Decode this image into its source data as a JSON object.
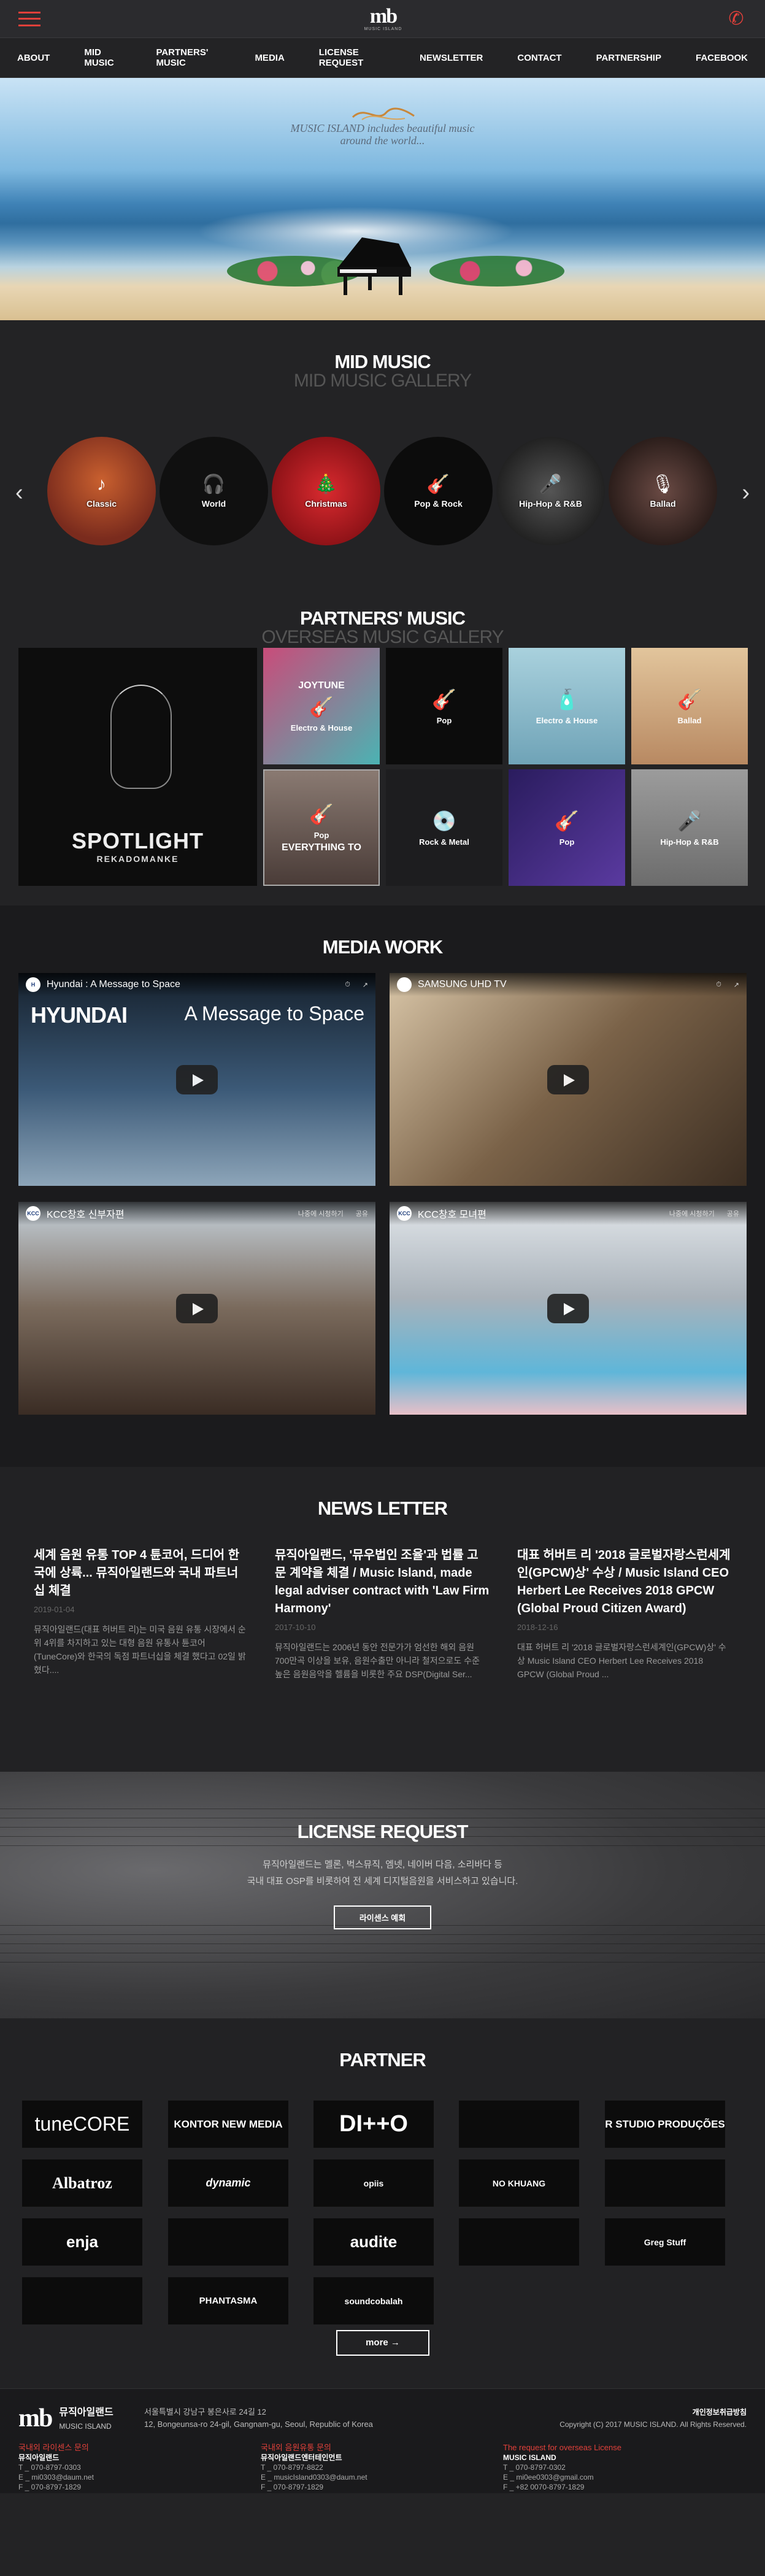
{
  "brand": {
    "logo_text": "mb",
    "logo_sub": "MUSIC ISLAND"
  },
  "nav": [
    "ABOUT",
    "MID MUSIC",
    "PARTNERS' MUSIC",
    "MEDIA",
    "LICENSE REQUEST",
    "NEWSLETTER",
    "CONTACT",
    "PARTNERSHIP",
    "FACEBOOK"
  ],
  "hero": {
    "caption_line1": "MUSIC ISLAND includes beautiful music",
    "caption_line2": "around the world..."
  },
  "mid_music": {
    "title": "MID MUSIC",
    "subtitle": "MID MUSIC GALLERY",
    "items": [
      {
        "label": "Classic",
        "color": "#7a2b1d"
      },
      {
        "label": "World",
        "color": "#101010"
      },
      {
        "label": "Christmas",
        "color": "#a3161b"
      },
      {
        "label": "Pop & Rock",
        "color": "#0c0c0c"
      },
      {
        "label": "Hip-Hop & R&B",
        "color": "#2a2a2a"
      },
      {
        "label": "Ballad",
        "color": "#3c2a26"
      }
    ]
  },
  "partners_music": {
    "title": "PARTNERS' MUSIC",
    "subtitle": "OVERSEAS MUSIC GALLERY",
    "feature_title": "SPOTLIGHT",
    "feature_sub": "REKADOMANKE",
    "tiles": [
      {
        "label": "Electro & House",
        "top_text": "JOYTUNE",
        "color": "#b8446c"
      },
      {
        "label": "Pop",
        "top_text": "",
        "color": "#0c0c0c"
      },
      {
        "label": "Electro & House",
        "top_text": "",
        "color": "#8fb9c8"
      },
      {
        "label": "Ballad",
        "top_text": "",
        "color": "#c89e7a"
      },
      {
        "label": "Pop",
        "top_text": "EVERYTHING TO",
        "color": "#6b5a55"
      },
      {
        "label": "Rock & Metal",
        "top_text": "",
        "color": "#222224"
      },
      {
        "label": "Pop",
        "top_text": "",
        "color": "#3a2a6a"
      },
      {
        "label": "Hip-Hop & R&B",
        "top_text": "",
        "color": "#8c8c8c"
      }
    ]
  },
  "media_work": {
    "title": "MEDIA WORK",
    "videos": [
      {
        "title": "Hyundai : A Message to Space",
        "badge": "H",
        "overlay_left": "HYUNDAI",
        "overlay_right": "A Message to Space",
        "watch_later": "나중에 시청하기",
        "share": "공유",
        "bg": "#3a4a5c"
      },
      {
        "title": "SAMSUNG UHD TV",
        "badge": "",
        "overlay_left": "",
        "overlay_right": "",
        "watch_later": "나중에 시청하기",
        "share": "공유",
        "bg": "#6b5a48"
      },
      {
        "title": "KCC창호 신부자편",
        "badge": "KCC",
        "overlay_left": "",
        "overlay_right": "",
        "watch_later": "나중에 시청하기",
        "share": "공유",
        "bg": "#5a5048"
      },
      {
        "title": "KCC창호 모녀편",
        "badge": "KCC",
        "overlay_left": "",
        "overlay_right": "",
        "watch_later": "나중에 시청하기",
        "share": "공유",
        "bg": "#8a8a8c"
      }
    ]
  },
  "news_letter": {
    "title": "NEWS LETTER",
    "items": [
      {
        "headline": "세계 음원 유통 TOP 4 튠코어, 드디어 한국에 상륙... 뮤직아일랜드와 국내 파트너십 체결",
        "date": "2019-01-04",
        "excerpt": "뮤직아일랜드(대표 허버트 리)는 미국 음원 유통 시장에서 순위 4위를 차지하고 있는 대형 음원 유통사 튠코어(TuneCore)와 한국의 독점 파트너십을 체결 했다고 02일 밝혔다...."
      },
      {
        "headline": "뮤직아일랜드, '뮤우법인 조율'과 법률 고문 계약을 체결 / Music Island, made legal adviser contract with 'Law Firm Harmony'",
        "date": "2017-10-10",
        "excerpt": "뮤직아일랜드는 2006년 동안 전문가가 엄선한 해외 음원 700만곡 이상을 보유, 음원수출만 아니라 철저으로도 수준 높은 음원음악을 헬륨을 비롯한 주요 DSP(Digital Ser..."
      },
      {
        "headline": "대표 허버트 리 '2018 글로벌자랑스런세계인(GPCW)상' 수상 / Music Island CEO Herbert Lee Receives 2018 GPCW (Global Proud Citizen Award)",
        "date": "2018-12-16",
        "excerpt": "대표 허버트 리 '2018 글로벌자랑스런세계인(GPCW)상' 수상 Music Island CEO Herbert Lee Receives 2018 GPCW (Global Proud ..."
      }
    ]
  },
  "license": {
    "title": "LICENSE REQUEST",
    "line1": "뮤직아일랜드는 멜론, 벅스뮤직, 엠넷, 네이버 다음, 소리바다 등",
    "line2": "국내 대표 OSP를 비롯하여 전 세계 디지털음원을 서비스하고 있습니다.",
    "button": "라이센스 예회"
  },
  "partner": {
    "title": "PARTNER",
    "logos": [
      "tuneCORE",
      "KONTOR NEW MEDIA",
      "DI++O",
      "",
      "R STUDIO PRODUÇÕES",
      "Albatroz",
      "dynamic",
      "opiis",
      "NO KHUANG",
      "",
      "enja",
      "",
      "audite",
      "",
      "Greg Stuff",
      "",
      "PHANTASMA",
      "soundcobalah"
    ],
    "more": "more"
  },
  "footer": {
    "company_ko": "뮤직아일랜드",
    "company_en": "MUSIC ISLAND",
    "address_ko": "서울특별시 강남구 봉은사로 24길 12",
    "address_en": "12, Bongeunsa-ro 24-gil, Gangnam-gu, Seoul, Republic of Korea",
    "privacy": "개인정보취급방침",
    "copyright": "Copyright (C) 2017 MUSIC ISLAND. All Rights Reserved.",
    "contacts": [
      {
        "head": "국내외 라이센스 문의",
        "name": "뮤직아일랜드",
        "t": "T _ 070-8797-0303",
        "e": "E _ mi0303@daum.net",
        "f": "F _ 070-8797-1829"
      },
      {
        "head": "국내외 음원유통 문의",
        "name": "뮤직아일랜드엔터테인먼트",
        "t": "T _ 070-8797-8822",
        "e": "E _ musicIsland0303@daum.net",
        "f": "F _ 070-8797-1829"
      },
      {
        "head": "The request for overseas License",
        "name": "MUSIC ISLAND",
        "t": "T _ 070-8797-0302",
        "e": "E _ mi0ee0303@gmail.com",
        "f": "F _ +82 0070-8797-1829"
      }
    ]
  }
}
